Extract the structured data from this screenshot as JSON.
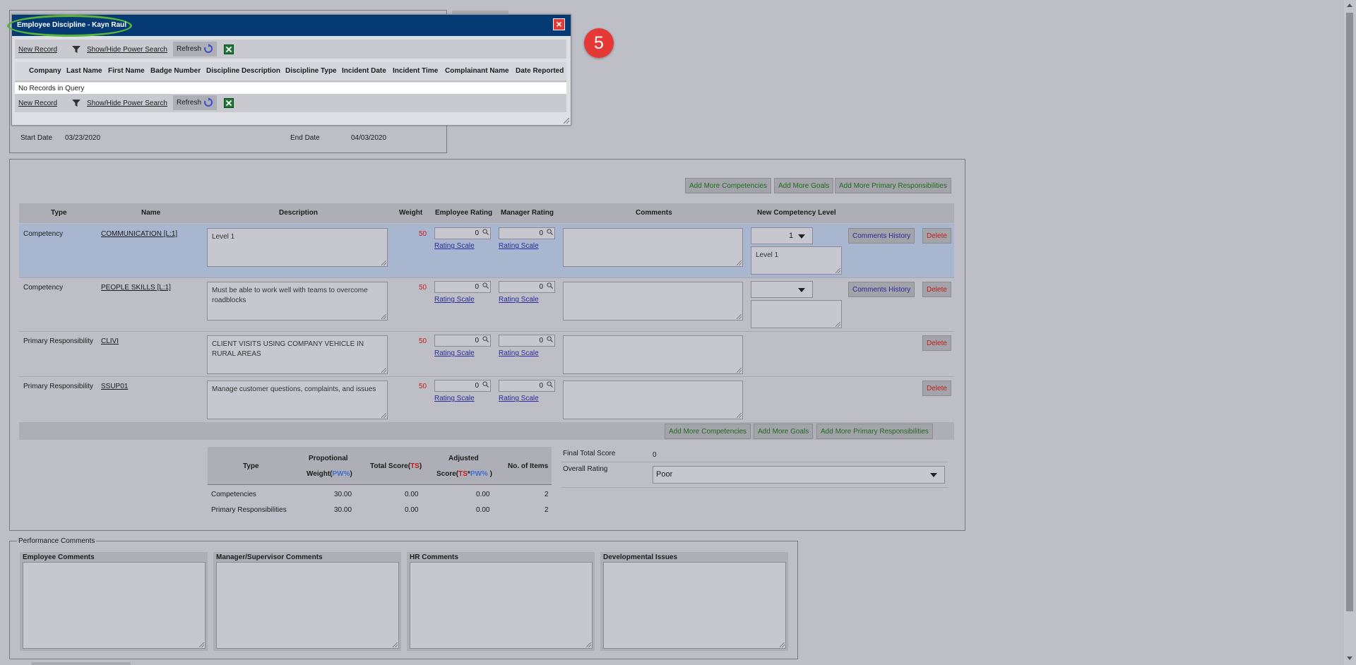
{
  "modal": {
    "title": "Employee Discipline - Kayn Raul",
    "close_symbol": "×",
    "toolbar": {
      "new_record": "New Record",
      "power_search": "Show/Hide Power Search",
      "refresh": "Refresh"
    },
    "columns": [
      "Company",
      "Last Name",
      "First Name",
      "Badge Number",
      "Discipline Description",
      "Discipline Type",
      "Incident Date",
      "Incident Time",
      "Complainant Name",
      "Date Reported"
    ],
    "empty_message": "No Records in Query",
    "step_badge": "5"
  },
  "header_fields": {
    "start_label": "Start Date",
    "start_value": "03/23/2020",
    "end_label": "End Date",
    "end_value": "04/03/2020"
  },
  "actions": {
    "add_competencies": "Add More Competencies",
    "add_goals": "Add More Goals",
    "add_primary": "Add More Primary Responsibilities"
  },
  "grid": {
    "columns": {
      "type": "Type",
      "name": "Name",
      "description": "Description",
      "weight": "Weight",
      "employee_rating": "Employee Rating",
      "manager_rating": "Manager Rating",
      "comments": "Comments",
      "new_level": "New Competency Level"
    },
    "rating_scale": "Rating Scale",
    "comments_history": "Comments History",
    "delete": "Delete",
    "rows": [
      {
        "type": "Competency",
        "name": "COMMUNICATION [L:1]",
        "description": "Level 1",
        "weight": "50",
        "employee_rating": "0",
        "manager_rating": "0",
        "level_select": "1",
        "level_text": "Level 1"
      },
      {
        "type": "Competency",
        "name": "PEOPLE SKILLS [L:1]",
        "description": "Must be able to work well with teams to overcome roadblocks",
        "weight": "50",
        "employee_rating": "0",
        "manager_rating": "0",
        "level_select": "",
        "level_text": ""
      },
      {
        "type": "Primary Responsibility",
        "name": "CLIVI",
        "description": "CLIENT VISITS USING COMPANY VEHICLE IN RURAL AREAS",
        "weight": "50",
        "employee_rating": "0",
        "manager_rating": "0"
      },
      {
        "type": "Primary Responsibility",
        "name": "SSUP01",
        "description": "Manage customer questions, complaints, and issues",
        "weight": "50",
        "employee_rating": "0",
        "manager_rating": "0"
      }
    ]
  },
  "summary": {
    "h_type": "Type",
    "h_weight_1": "Propotional",
    "h_weight_2": "Weight(",
    "h_pw": "PW%",
    "h_close": ")",
    "h_total": "Total Score(",
    "h_ts": "TS",
    "h_adjusted_1": "Adjusted",
    "h_adjusted_2": "Score(",
    "h_star": "*",
    "h_pw2": "PW%",
    "h_adj_close": " )",
    "h_items": "No. of Items",
    "rows": [
      {
        "type": "Competencies",
        "weight": "30.00",
        "total": "0.00",
        "adjusted": "0.00",
        "items": "2"
      },
      {
        "type": "Primary Responsibilities",
        "weight": "30.00",
        "total": "0.00",
        "adjusted": "0.00",
        "items": "2"
      }
    ],
    "final_total_label": "Final Total Score",
    "final_total_value": "0",
    "overall_rating_label": "Overall Rating",
    "overall_rating_value": "Poor"
  },
  "performance_comments": {
    "legend": "Performance Comments",
    "employee": "Employee Comments",
    "manager": "Manager/Supervisor Comments",
    "hr": "HR Comments",
    "developmental": "Developmental Issues"
  },
  "colors": {
    "modal_title_bg": "#053a74",
    "badge_red": "#e53935",
    "highlight_row": "#a9b6cf",
    "oval": "#58b33a"
  }
}
